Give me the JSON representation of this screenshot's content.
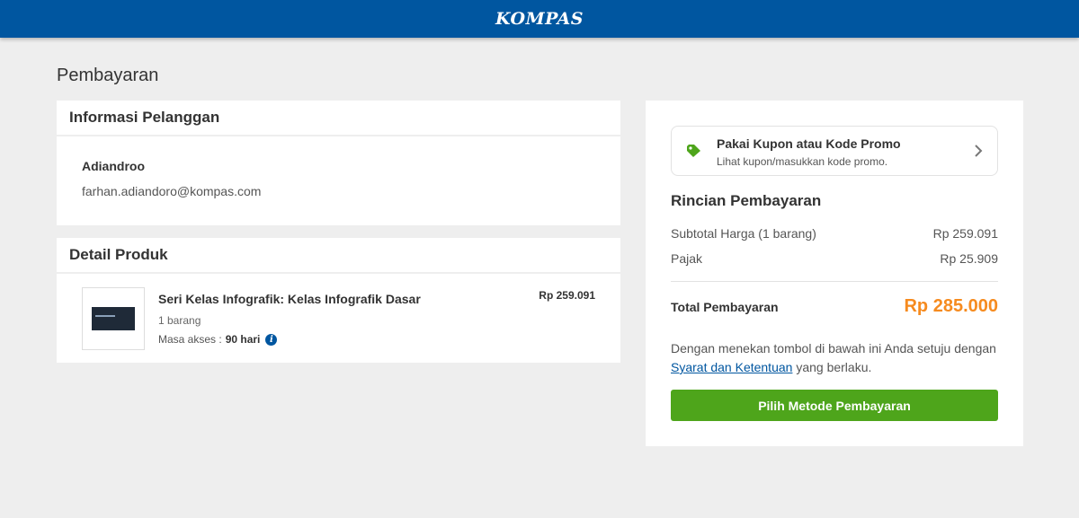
{
  "header": {
    "logo": "KOMPAS"
  },
  "page": {
    "title": "Pembayaran"
  },
  "customer": {
    "heading": "Informasi Pelanggan",
    "name": "Adiandroo",
    "email": "farhan.adiandoro@kompas.com"
  },
  "product": {
    "heading": "Detail Produk",
    "name": "Seri Kelas Infografik: Kelas Infografik Dasar",
    "quantity": "1 barang",
    "access_label": "Masa akses :",
    "access_value": "90 hari",
    "price": "Rp 259.091"
  },
  "coupon": {
    "title": "Pakai Kupon atau Kode Promo",
    "subtitle": "Lihat kupon/masukkan kode promo."
  },
  "summary": {
    "heading": "Rincian Pembayaran",
    "subtotal_label": "Subtotal Harga (1 barang)",
    "subtotal_value": "Rp 259.091",
    "tax_label": "Pajak",
    "tax_value": "Rp 25.909",
    "total_label": "Total Pembayaran",
    "total_value": "Rp 285.000",
    "terms_before": "Dengan menekan tombol di bawah ini Anda setuju dengan ",
    "terms_link": "Syarat dan Ketentuan",
    "terms_after": " yang berlaku.",
    "pay_button": "Pilih Metode Pembayaran"
  },
  "colors": {
    "brand": "#0056a0",
    "accent_total": "#f68b1f",
    "button": "#4ea51b",
    "tag_icon": "#4ea51b"
  },
  "icons": {
    "coupon": "tag-icon",
    "coupon_arrow": "chevron-right-icon",
    "access_info": "info-icon"
  }
}
